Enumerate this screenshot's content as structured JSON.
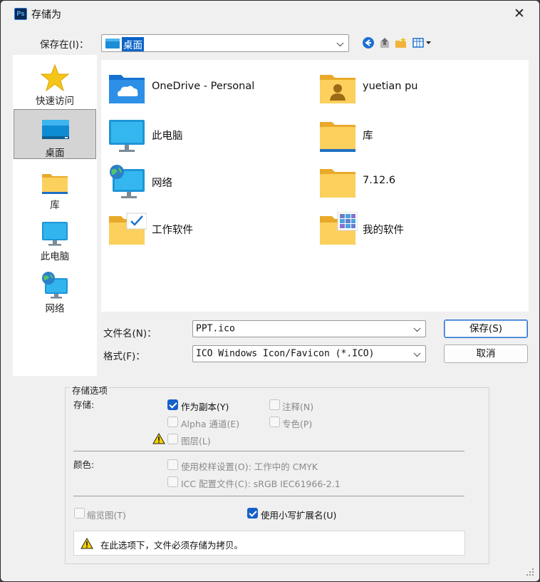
{
  "window": {
    "title": "存储为",
    "app_icon_text": "Ps",
    "close_glyph": "✕"
  },
  "save_in": {
    "label": "保存在(I)：",
    "value": "桌面"
  },
  "places": [
    {
      "label": "快速访问",
      "icon": "star-icon"
    },
    {
      "label": "桌面",
      "icon": "desktop-icon",
      "selected": true
    },
    {
      "label": "库",
      "icon": "library-folder-icon"
    },
    {
      "label": "此电脑",
      "icon": "monitor-icon"
    },
    {
      "label": "网络",
      "icon": "network-icon"
    }
  ],
  "files": [
    {
      "name": "OneDrive - Personal",
      "icon": "onedrive-folder-icon"
    },
    {
      "name": "yuetian pu",
      "icon": "user-folder-icon"
    },
    {
      "name": "此电脑",
      "icon": "monitor-icon"
    },
    {
      "name": "库",
      "icon": "library-folder-icon"
    },
    {
      "name": "网络",
      "icon": "network-icon"
    },
    {
      "name": "7.12.6",
      "icon": "folder-icon"
    },
    {
      "name": "工作软件",
      "icon": "checked-folder-icon"
    },
    {
      "name": "我的软件",
      "icon": "apps-folder-icon"
    }
  ],
  "filename": {
    "label": "文件名(N)：",
    "value": "PPT.ico"
  },
  "format": {
    "label": "格式(F)：",
    "value": "ICO Windows Icon/Favicon (*.ICO)"
  },
  "buttons": {
    "save": "保存(S)",
    "cancel": "取消"
  },
  "options": {
    "legend": "存储选项",
    "storage_label": "存储:",
    "as_copy": {
      "label": "作为副本(Y)",
      "checked": true
    },
    "notes": {
      "label": "注释(N)",
      "checked": false
    },
    "alpha": {
      "label": "Alpha 通道(E)",
      "checked": false
    },
    "spot": {
      "label": "专色(P)",
      "checked": false
    },
    "layers": {
      "label": "图层(L)",
      "checked": false
    },
    "color_label": "颜色:",
    "proof": {
      "label": "使用校样设置(O):  工作中的 CMYK",
      "checked": false
    },
    "icc": {
      "label": "ICC 配置文件(C):  sRGB IEC61966-2.1",
      "checked": false
    },
    "thumbnail": {
      "label": "缩览图(T)",
      "checked": false
    },
    "lowercase": {
      "label": "使用小写扩展名(U)",
      "checked": true
    },
    "warning": "在此选项下，文件必须存储为拷贝。"
  },
  "colors": {
    "accent": "#1660c8",
    "folder": "#f6c744",
    "selected_place": "#d4d4d4"
  }
}
